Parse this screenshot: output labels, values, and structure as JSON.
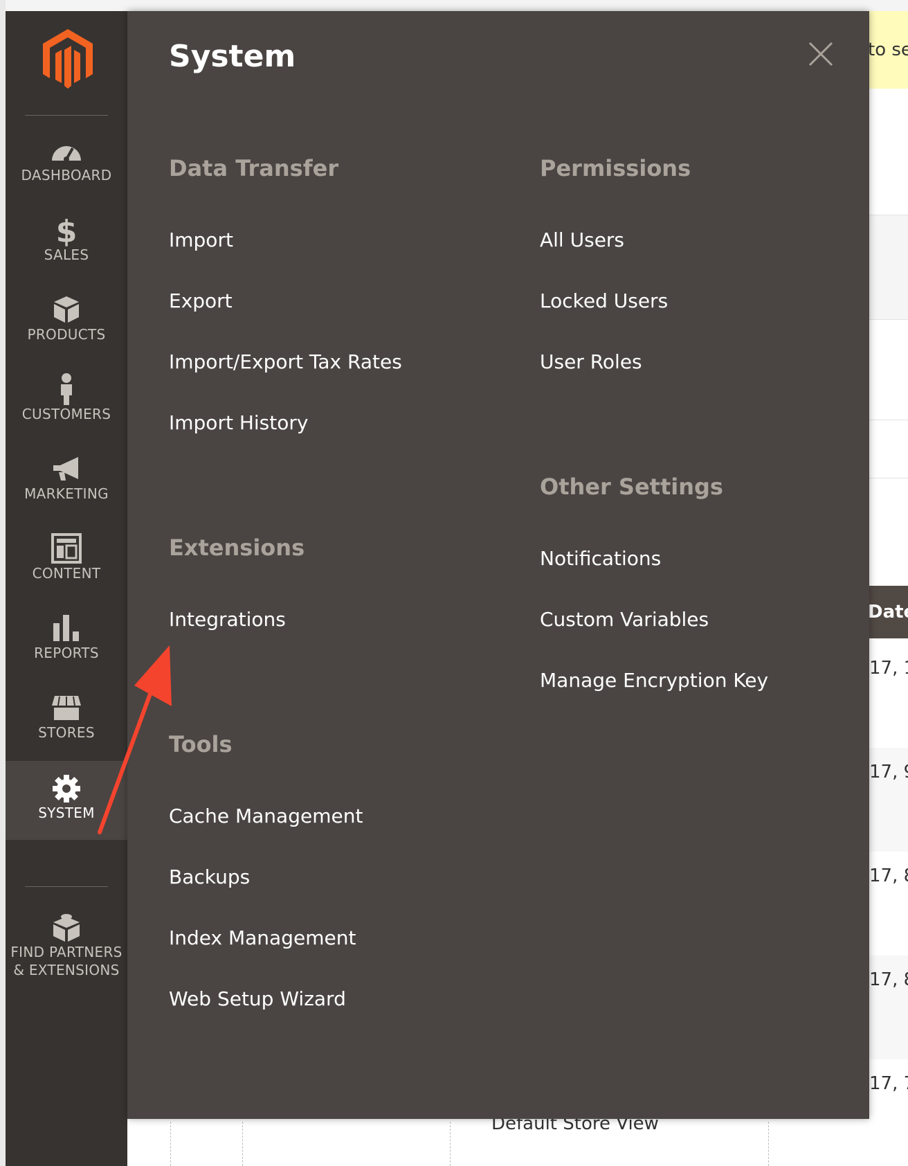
{
  "sidebar": {
    "items": [
      {
        "label": "DASHBOARD",
        "icon": "dashboard-icon"
      },
      {
        "label": "SALES",
        "icon": "dollar-icon"
      },
      {
        "label": "PRODUCTS",
        "icon": "box-icon"
      },
      {
        "label": "CUSTOMERS",
        "icon": "person-icon"
      },
      {
        "label": "MARKETING",
        "icon": "megaphone-icon"
      },
      {
        "label": "CONTENT",
        "icon": "layout-icon"
      },
      {
        "label": "REPORTS",
        "icon": "bar-chart-icon"
      },
      {
        "label": "STORES",
        "icon": "storefront-icon"
      },
      {
        "label": "SYSTEM",
        "icon": "gear-icon",
        "active": true
      },
      {
        "label": "FIND PARTNERS",
        "label2": "& EXTENSIONS",
        "icon": "blocks-icon"
      }
    ]
  },
  "panel": {
    "title": "System",
    "data_transfer": {
      "title": "Data Transfer",
      "links": [
        "Import",
        "Export",
        "Import/Export Tax Rates",
        "Import History"
      ]
    },
    "extensions": {
      "title": "Extensions",
      "links": [
        "Integrations"
      ]
    },
    "tools": {
      "title": "Tools",
      "links": [
        "Cache Management",
        "Backups",
        "Index Management",
        "Web Setup Wizard"
      ]
    },
    "permissions": {
      "title": "Permissions",
      "links": [
        "All Users",
        "Locked Users",
        "User Roles"
      ]
    },
    "other_settings": {
      "title": "Other Settings",
      "links": [
        "Notifications",
        "Custom Variables",
        "Manage Encryption Key"
      ]
    }
  },
  "background": {
    "notice_text": "to se",
    "date_header": "Date",
    "date_cells": [
      "17, 1",
      "17, 9",
      "17, 8",
      "17, 8",
      "17, 7"
    ],
    "store_view": "Default Store View"
  },
  "colors": {
    "sidebar": "#373330",
    "panel": "#4a4542",
    "section_title": "#aaa39c",
    "logo": "#f26322",
    "annotation_arrow": "#f4442e",
    "notice": "#fffbbb"
  }
}
